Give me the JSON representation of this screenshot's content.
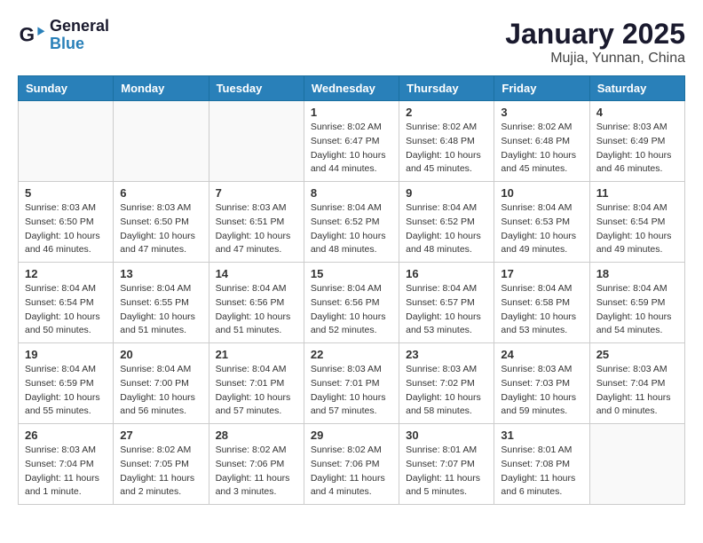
{
  "header": {
    "logo_line1": "General",
    "logo_line2": "Blue",
    "month": "January 2025",
    "location": "Mujia, Yunnan, China"
  },
  "weekdays": [
    "Sunday",
    "Monday",
    "Tuesday",
    "Wednesday",
    "Thursday",
    "Friday",
    "Saturday"
  ],
  "weeks": [
    [
      {
        "day": "",
        "content": ""
      },
      {
        "day": "",
        "content": ""
      },
      {
        "day": "",
        "content": ""
      },
      {
        "day": "1",
        "content": "Sunrise: 8:02 AM\nSunset: 6:47 PM\nDaylight: 10 hours\nand 44 minutes."
      },
      {
        "day": "2",
        "content": "Sunrise: 8:02 AM\nSunset: 6:48 PM\nDaylight: 10 hours\nand 45 minutes."
      },
      {
        "day": "3",
        "content": "Sunrise: 8:02 AM\nSunset: 6:48 PM\nDaylight: 10 hours\nand 45 minutes."
      },
      {
        "day": "4",
        "content": "Sunrise: 8:03 AM\nSunset: 6:49 PM\nDaylight: 10 hours\nand 46 minutes."
      }
    ],
    [
      {
        "day": "5",
        "content": "Sunrise: 8:03 AM\nSunset: 6:50 PM\nDaylight: 10 hours\nand 46 minutes."
      },
      {
        "day": "6",
        "content": "Sunrise: 8:03 AM\nSunset: 6:50 PM\nDaylight: 10 hours\nand 47 minutes."
      },
      {
        "day": "7",
        "content": "Sunrise: 8:03 AM\nSunset: 6:51 PM\nDaylight: 10 hours\nand 47 minutes."
      },
      {
        "day": "8",
        "content": "Sunrise: 8:04 AM\nSunset: 6:52 PM\nDaylight: 10 hours\nand 48 minutes."
      },
      {
        "day": "9",
        "content": "Sunrise: 8:04 AM\nSunset: 6:52 PM\nDaylight: 10 hours\nand 48 minutes."
      },
      {
        "day": "10",
        "content": "Sunrise: 8:04 AM\nSunset: 6:53 PM\nDaylight: 10 hours\nand 49 minutes."
      },
      {
        "day": "11",
        "content": "Sunrise: 8:04 AM\nSunset: 6:54 PM\nDaylight: 10 hours\nand 49 minutes."
      }
    ],
    [
      {
        "day": "12",
        "content": "Sunrise: 8:04 AM\nSunset: 6:54 PM\nDaylight: 10 hours\nand 50 minutes."
      },
      {
        "day": "13",
        "content": "Sunrise: 8:04 AM\nSunset: 6:55 PM\nDaylight: 10 hours\nand 51 minutes."
      },
      {
        "day": "14",
        "content": "Sunrise: 8:04 AM\nSunset: 6:56 PM\nDaylight: 10 hours\nand 51 minutes."
      },
      {
        "day": "15",
        "content": "Sunrise: 8:04 AM\nSunset: 6:56 PM\nDaylight: 10 hours\nand 52 minutes."
      },
      {
        "day": "16",
        "content": "Sunrise: 8:04 AM\nSunset: 6:57 PM\nDaylight: 10 hours\nand 53 minutes."
      },
      {
        "day": "17",
        "content": "Sunrise: 8:04 AM\nSunset: 6:58 PM\nDaylight: 10 hours\nand 53 minutes."
      },
      {
        "day": "18",
        "content": "Sunrise: 8:04 AM\nSunset: 6:59 PM\nDaylight: 10 hours\nand 54 minutes."
      }
    ],
    [
      {
        "day": "19",
        "content": "Sunrise: 8:04 AM\nSunset: 6:59 PM\nDaylight: 10 hours\nand 55 minutes."
      },
      {
        "day": "20",
        "content": "Sunrise: 8:04 AM\nSunset: 7:00 PM\nDaylight: 10 hours\nand 56 minutes."
      },
      {
        "day": "21",
        "content": "Sunrise: 8:04 AM\nSunset: 7:01 PM\nDaylight: 10 hours\nand 57 minutes."
      },
      {
        "day": "22",
        "content": "Sunrise: 8:03 AM\nSunset: 7:01 PM\nDaylight: 10 hours\nand 57 minutes."
      },
      {
        "day": "23",
        "content": "Sunrise: 8:03 AM\nSunset: 7:02 PM\nDaylight: 10 hours\nand 58 minutes."
      },
      {
        "day": "24",
        "content": "Sunrise: 8:03 AM\nSunset: 7:03 PM\nDaylight: 10 hours\nand 59 minutes."
      },
      {
        "day": "25",
        "content": "Sunrise: 8:03 AM\nSunset: 7:04 PM\nDaylight: 11 hours\nand 0 minutes."
      }
    ],
    [
      {
        "day": "26",
        "content": "Sunrise: 8:03 AM\nSunset: 7:04 PM\nDaylight: 11 hours\nand 1 minute."
      },
      {
        "day": "27",
        "content": "Sunrise: 8:02 AM\nSunset: 7:05 PM\nDaylight: 11 hours\nand 2 minutes."
      },
      {
        "day": "28",
        "content": "Sunrise: 8:02 AM\nSunset: 7:06 PM\nDaylight: 11 hours\nand 3 minutes."
      },
      {
        "day": "29",
        "content": "Sunrise: 8:02 AM\nSunset: 7:06 PM\nDaylight: 11 hours\nand 4 minutes."
      },
      {
        "day": "30",
        "content": "Sunrise: 8:01 AM\nSunset: 7:07 PM\nDaylight: 11 hours\nand 5 minutes."
      },
      {
        "day": "31",
        "content": "Sunrise: 8:01 AM\nSunset: 7:08 PM\nDaylight: 11 hours\nand 6 minutes."
      },
      {
        "day": "",
        "content": ""
      }
    ]
  ]
}
